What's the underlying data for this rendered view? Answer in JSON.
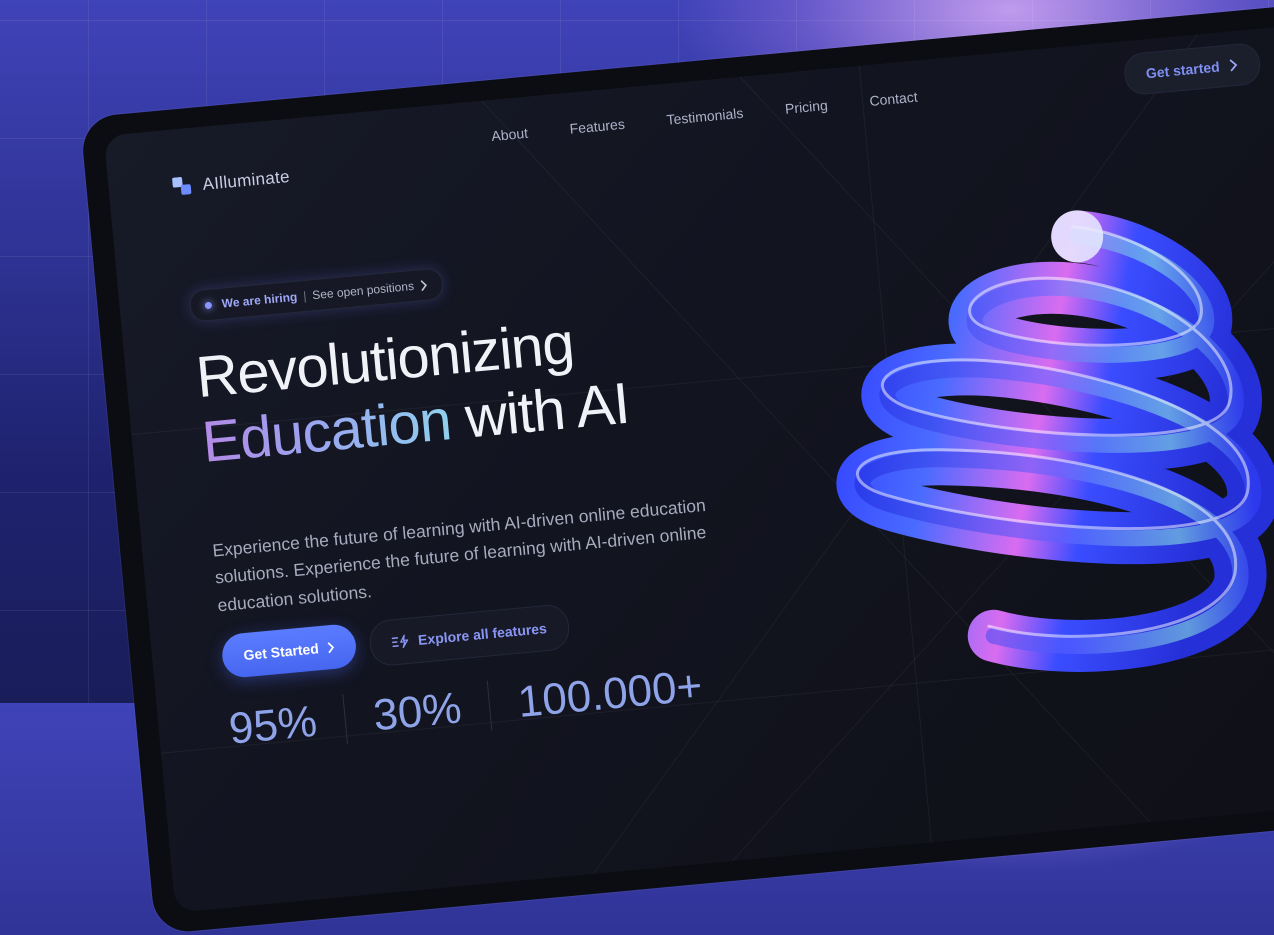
{
  "brand": {
    "name": "AIlluminate"
  },
  "nav": {
    "items": [
      "About",
      "Features",
      "Testimonials",
      "Pricing",
      "Contact"
    ],
    "cta_label": "Get started"
  },
  "announcement": {
    "badge": "We are hiring",
    "separator": "|",
    "link": "See open positions"
  },
  "hero": {
    "line1": "Revolutionizing",
    "highlight": "Education",
    "line2_rest": " with AI",
    "description": "Experience the future of learning with AI-driven online education solutions. Experience the future of learning with AI-driven online education solutions."
  },
  "buttons": {
    "primary": "Get Started",
    "secondary": "Explore all features"
  },
  "stats": [
    "95%",
    "30%",
    "100.000+"
  ],
  "icons": [
    "logo-icon",
    "chevron-right-icon",
    "sparkle-dot-icon",
    "bolt-list-icon",
    "spiral-3d-art"
  ],
  "colors": {
    "accent": "#5b7cff",
    "bg_outer": "#2f3395",
    "screen": "#121420",
    "gradient_start": "#b48ae6",
    "gradient_end": "#8fd0ee"
  }
}
